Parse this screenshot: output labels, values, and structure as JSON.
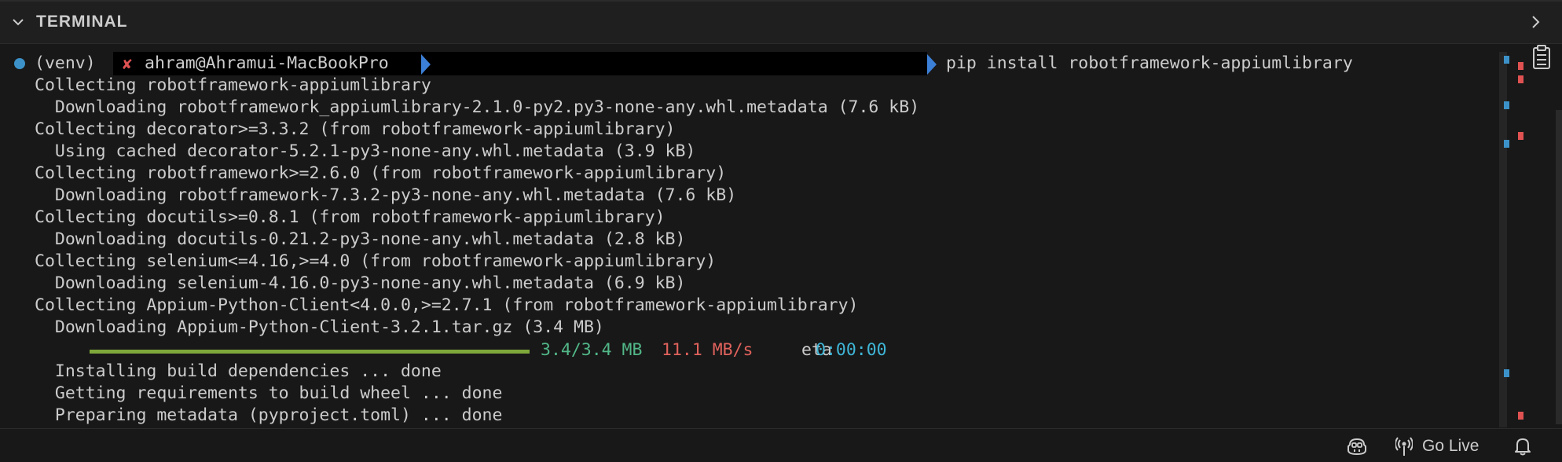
{
  "panel": {
    "title": "TERMINAL"
  },
  "prompt": {
    "venv": "(venv)",
    "status_icon": "x-icon",
    "user_host": "ahram@Ahramui-MacBookPro",
    "command": "pip install robotframework-appiumlibrary"
  },
  "output_lines": [
    "Collecting robotframework-appiumlibrary",
    "  Downloading robotframework_appiumlibrary-2.1.0-py2.py3-none-any.whl.metadata (7.6 kB)",
    "Collecting decorator>=3.3.2 (from robotframework-appiumlibrary)",
    "  Using cached decorator-5.2.1-py3-none-any.whl.metadata (3.9 kB)",
    "Collecting robotframework>=2.6.0 (from robotframework-appiumlibrary)",
    "  Downloading robotframework-7.3.2-py3-none-any.whl.metadata (7.6 kB)",
    "Collecting docutils>=0.8.1 (from robotframework-appiumlibrary)",
    "  Downloading docutils-0.21.2-py3-none-any.whl.metadata (2.8 kB)",
    "Collecting selenium<=4.16,>=4.0 (from robotframework-appiumlibrary)",
    "  Downloading selenium-4.16.0-py3-none-any.whl.metadata (6.9 kB)",
    "Collecting Appium-Python-Client<4.0.0,>=2.7.1 (from robotframework-appiumlibrary)",
    "  Downloading Appium-Python-Client-3.2.1.tar.gz (3.4 MB)"
  ],
  "progress": {
    "fraction": 1.0,
    "size": "3.4/3.4 MB",
    "rate": "11.1 MB/s",
    "eta_label": "eta",
    "eta": "0:00:00"
  },
  "output_lines_after": [
    "  Installing build dependencies ... done",
    "  Getting requirements to build wheel ... done",
    "  Preparing metadata (pyproject.toml) ... done"
  ],
  "statusbar": {
    "copilot_icon": "copilot-icon",
    "go_live_label": "Go Live",
    "bell_icon": "bell-icon"
  },
  "colors": {
    "background": "#181818",
    "progress_bar": "#7ea83a",
    "progress_size": "#52b788",
    "progress_rate": "#e0625c",
    "progress_eta": "#3fb5d6",
    "dot": "#3c92c8"
  }
}
